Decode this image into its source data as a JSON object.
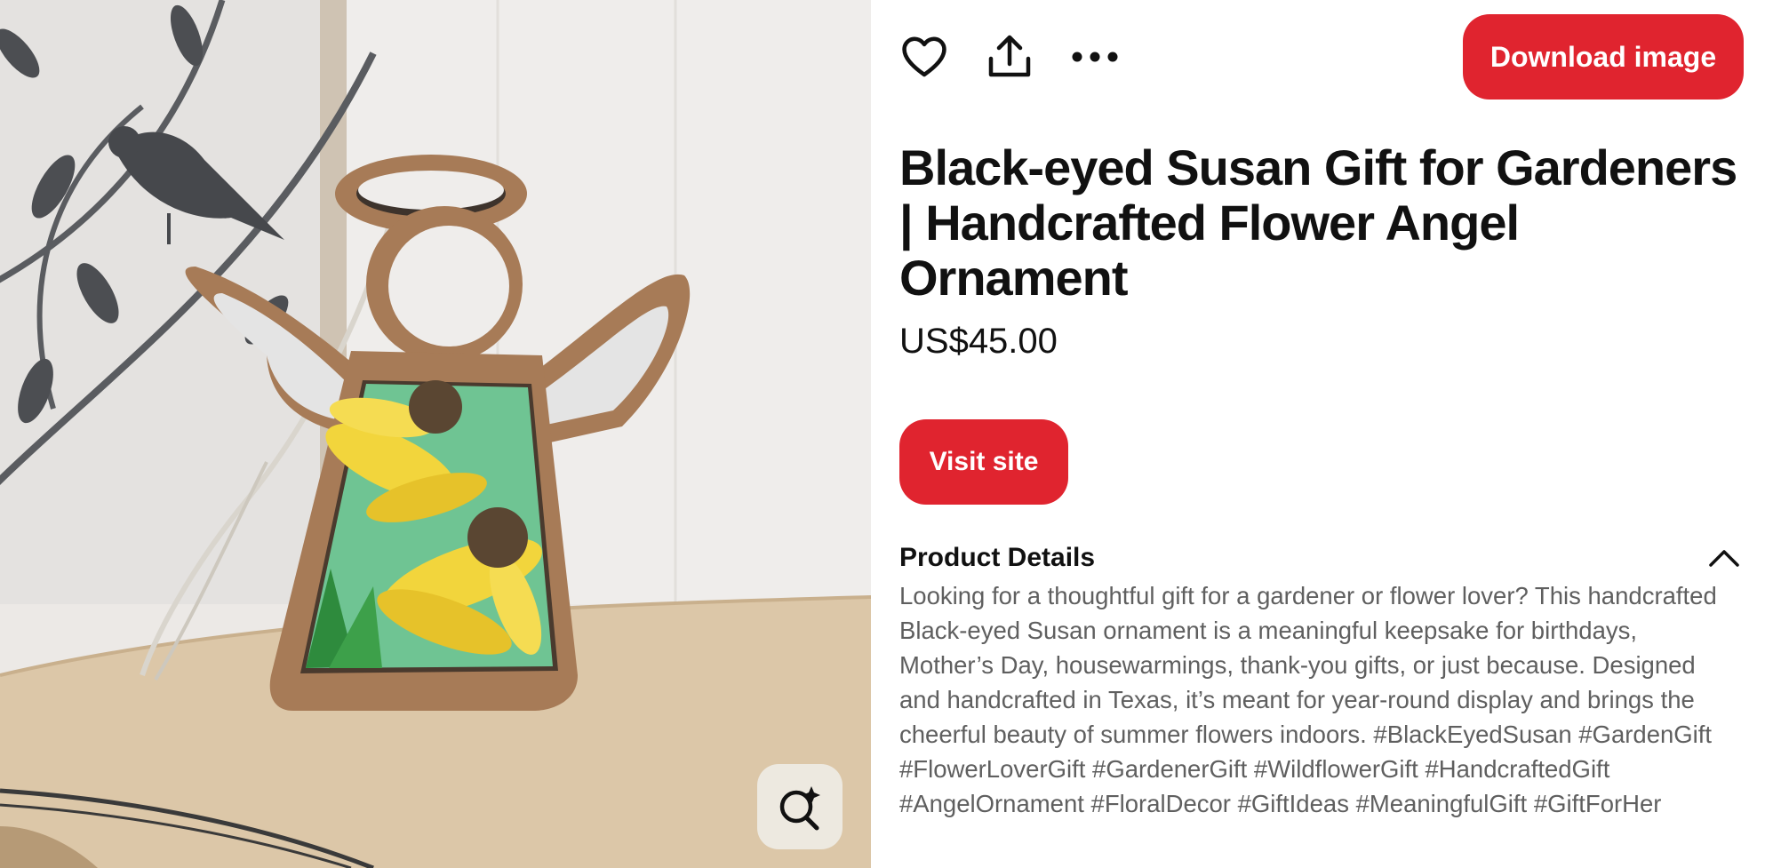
{
  "toolbar": {
    "like_icon": "heart-icon",
    "share_icon": "share-upload-icon",
    "more_icon": "more-dots-icon",
    "download_label": "Download image",
    "accent_color": "#e0242f"
  },
  "product": {
    "title": "Black-eyed Susan Gift for Gardeners | Handcrafted Flower Angel Ornament",
    "price": "US$45.00",
    "visit_label": "Visit site"
  },
  "details": {
    "heading": "Product Details",
    "toggle_icon": "chevron-up-icon",
    "description": "Looking for a thoughtful gift for a gardener or flower lover? This handcrafted Black-eyed Susan ornament is a meaningful keepsake for birthdays, Mother’s Day, housewarmings, thank-you gifts, or just because. Designed and handcrafted in Texas, it’s meant for year-round display and brings the cheerful beauty of summer flowers indoors. #BlackEyedSusan #GardenGift #FlowerLoverGift #GardenerGift #WildflowerGift #HandcraftedGift #AngelOrnament #FloralDecor #GiftIdeas #MeaningfulGift #GiftForHer"
  },
  "image": {
    "visual_search_icon": "visual-search-sparkle-icon"
  }
}
